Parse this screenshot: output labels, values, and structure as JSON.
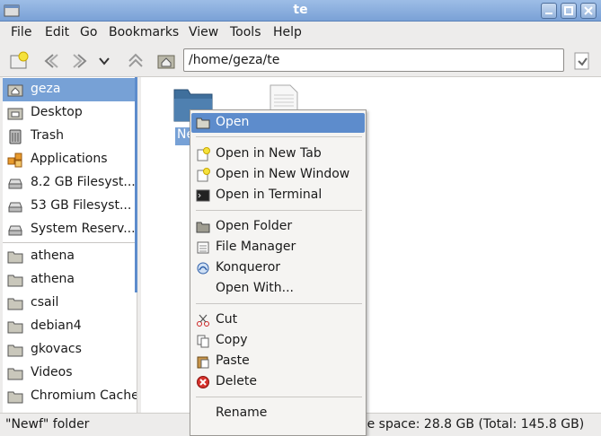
{
  "window": {
    "title": "te"
  },
  "menubar": [
    "File",
    "Edit",
    "Go",
    "Bookmarks",
    "View",
    "Tools",
    "Help"
  ],
  "toolbar": {
    "address": "/home/geza/te"
  },
  "sidebar": {
    "places": [
      "geza",
      "Desktop",
      "Trash",
      "Applications",
      "8.2 GB Filesyst...",
      "53 GB Filesyst...",
      "System Reserv..."
    ],
    "bookmarks": [
      "athena",
      "athena",
      "csail",
      "debian4",
      "gkovacs",
      "Videos",
      "Chromium Cache"
    ]
  },
  "files": {
    "selected_label": "Ne"
  },
  "context_menu": {
    "items": [
      "Open",
      "Open in New Tab",
      "Open in New Window",
      "Open in Terminal",
      "Open Folder",
      "File Manager",
      "Konqueror",
      "Open With...",
      "Cut",
      "Copy",
      "Paste",
      "Delete",
      "Rename"
    ]
  },
  "status": {
    "left": "\"Newf\" folder",
    "right": "ee space: 28.8 GB (Total: 145.8 GB)"
  },
  "colors": {
    "selection": "#77a1d6",
    "menu_highlight": "#5d8ccc",
    "titlebar": "#8aaede"
  }
}
